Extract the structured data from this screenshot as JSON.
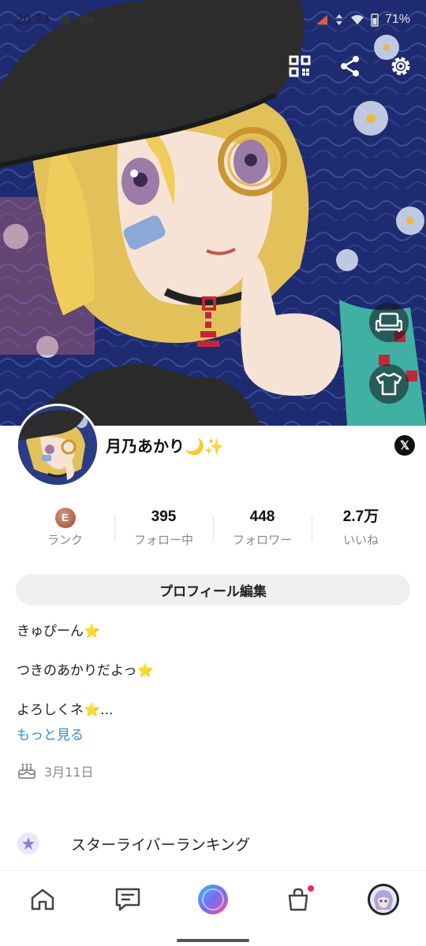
{
  "status_bar": {
    "time": "20:23",
    "battery": "71%"
  },
  "profile": {
    "name": "月乃あかり🌙✨",
    "social_link": "𝕏",
    "stats": [
      {
        "value": "E",
        "label": "ランク"
      },
      {
        "value": "395",
        "label": "フォロー中"
      },
      {
        "value": "448",
        "label": "フォロワー"
      },
      {
        "value": "2.7万",
        "label": "いいね"
      }
    ],
    "edit_button": "プロフィール編集",
    "bio": {
      "line1": "きゅぴーん⭐",
      "line2": "つきのあかりだよっ⭐",
      "line3": "よろしくネ⭐..."
    },
    "more_link": "もっと見る",
    "birthday": "3月11日",
    "ranking_label": "スターライバーランキング"
  },
  "icons": {
    "top_actions": [
      "qr-code-icon",
      "share-icon",
      "settings-icon"
    ],
    "side_buttons": [
      "sofa-icon",
      "tshirt-icon"
    ],
    "nav": [
      "home-icon",
      "chat-icon",
      "live-icon",
      "shop-icon",
      "avatar"
    ]
  },
  "colors": {
    "link": "#2f8ee0",
    "notification_dot": "#e63050",
    "rank_badge": "#a9624a"
  }
}
